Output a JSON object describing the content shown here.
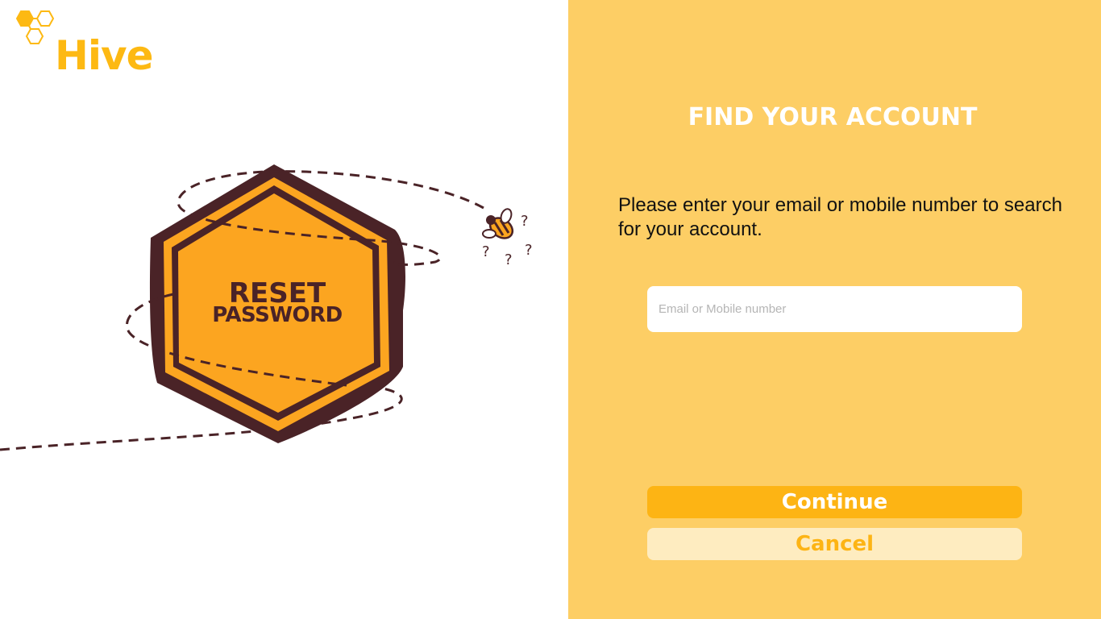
{
  "brand": {
    "name": "Hive",
    "color": "#fdb913"
  },
  "illustration": {
    "line1": "RESET",
    "line2": "PASSWORD",
    "icon": "bee-icon"
  },
  "form": {
    "title": "FIND YOUR ACCOUNT",
    "instructions": "Please enter your email or mobile number to search for your account.",
    "email_placeholder": "Email or Mobile number",
    "email_value": "",
    "continue_label": "Continue",
    "cancel_label": "Cancel"
  },
  "colors": {
    "panel_bg": "#fdce65",
    "accent": "#fdb414",
    "cancel_bg": "#feecc0",
    "hex_outline": "#4a2327",
    "hex_fill": "#fca520"
  }
}
